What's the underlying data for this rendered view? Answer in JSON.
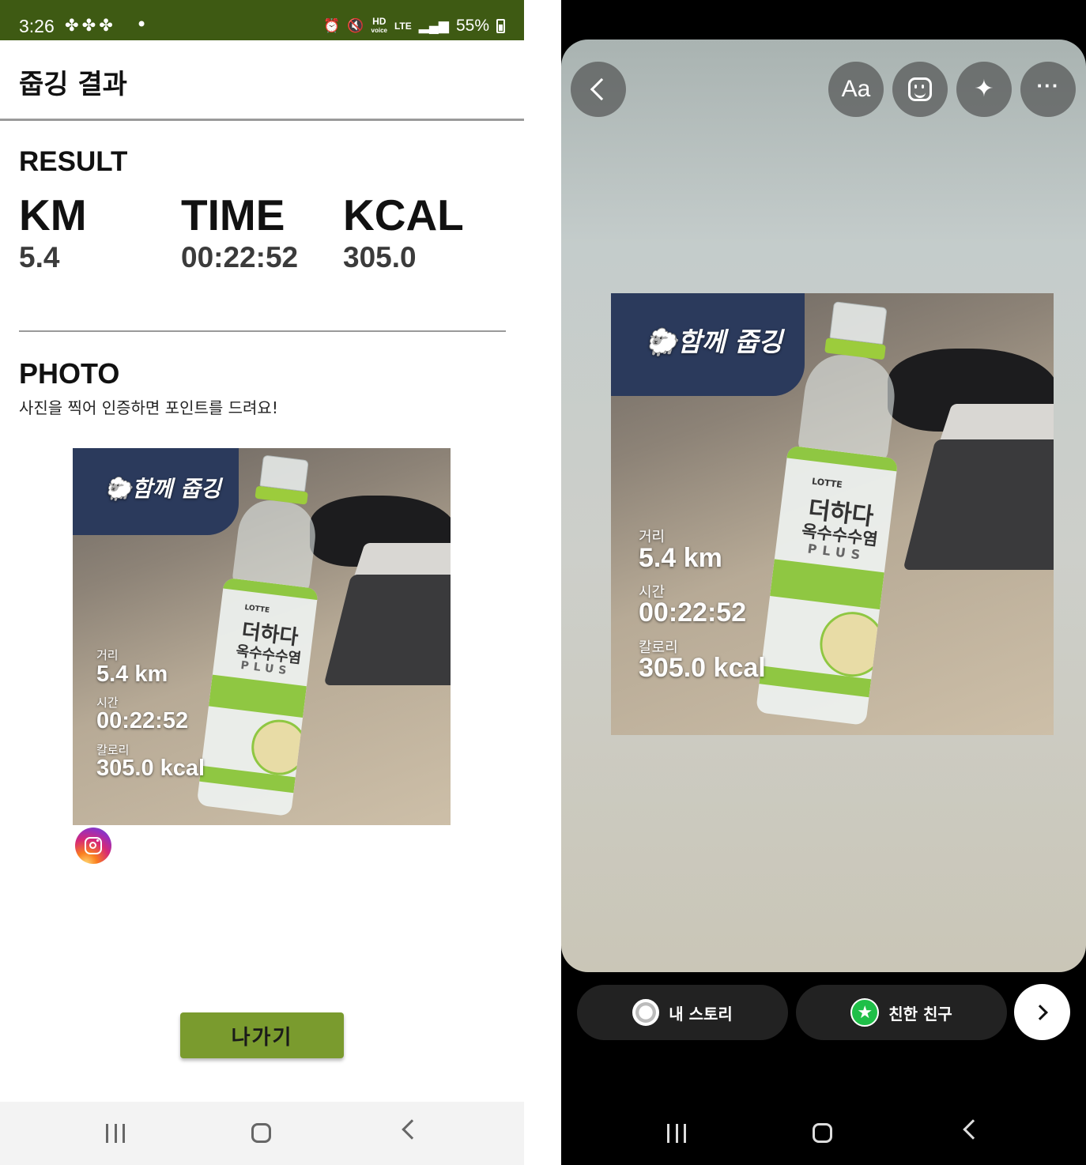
{
  "status_bar": {
    "time": "3:26",
    "notification_icons": [
      "clover-icon",
      "clover-icon",
      "clover-icon"
    ],
    "dot": "•",
    "hd_label": "HD",
    "hd_sub": "voice",
    "lte_label": "LTE",
    "battery": "55%"
  },
  "app_bar": {
    "title": "줍깅 결과"
  },
  "result": {
    "heading": "RESULT",
    "stats": [
      {
        "label": "KM",
        "value": "5.4"
      },
      {
        "label": "TIME",
        "value": "00:22:52"
      },
      {
        "label": "KCAL",
        "value": "305.0"
      }
    ]
  },
  "photo_section": {
    "heading": "PHOTO",
    "subtitle": "사진을 찍어 인증하면 포인트를 드려요!"
  },
  "photo_overlay": {
    "title": "함께 줍깅",
    "distance_label": "거리",
    "distance_value": "5.4 km",
    "time_label": "시간",
    "time_value": "00:22:52",
    "calorie_label": "칼로리",
    "calorie_value": "305.0 kcal"
  },
  "exit_button": {
    "label": "나가기"
  },
  "story_editor": {
    "text_tool_label": "Aa",
    "more_label": "···",
    "my_story_label": "내 스토리",
    "close_friends_label": "친한 친구"
  },
  "colors": {
    "status_bar_bg": "#3e5a13",
    "exit_button_bg": "#7a9b2e",
    "close_friends_green": "#1fbf48"
  }
}
